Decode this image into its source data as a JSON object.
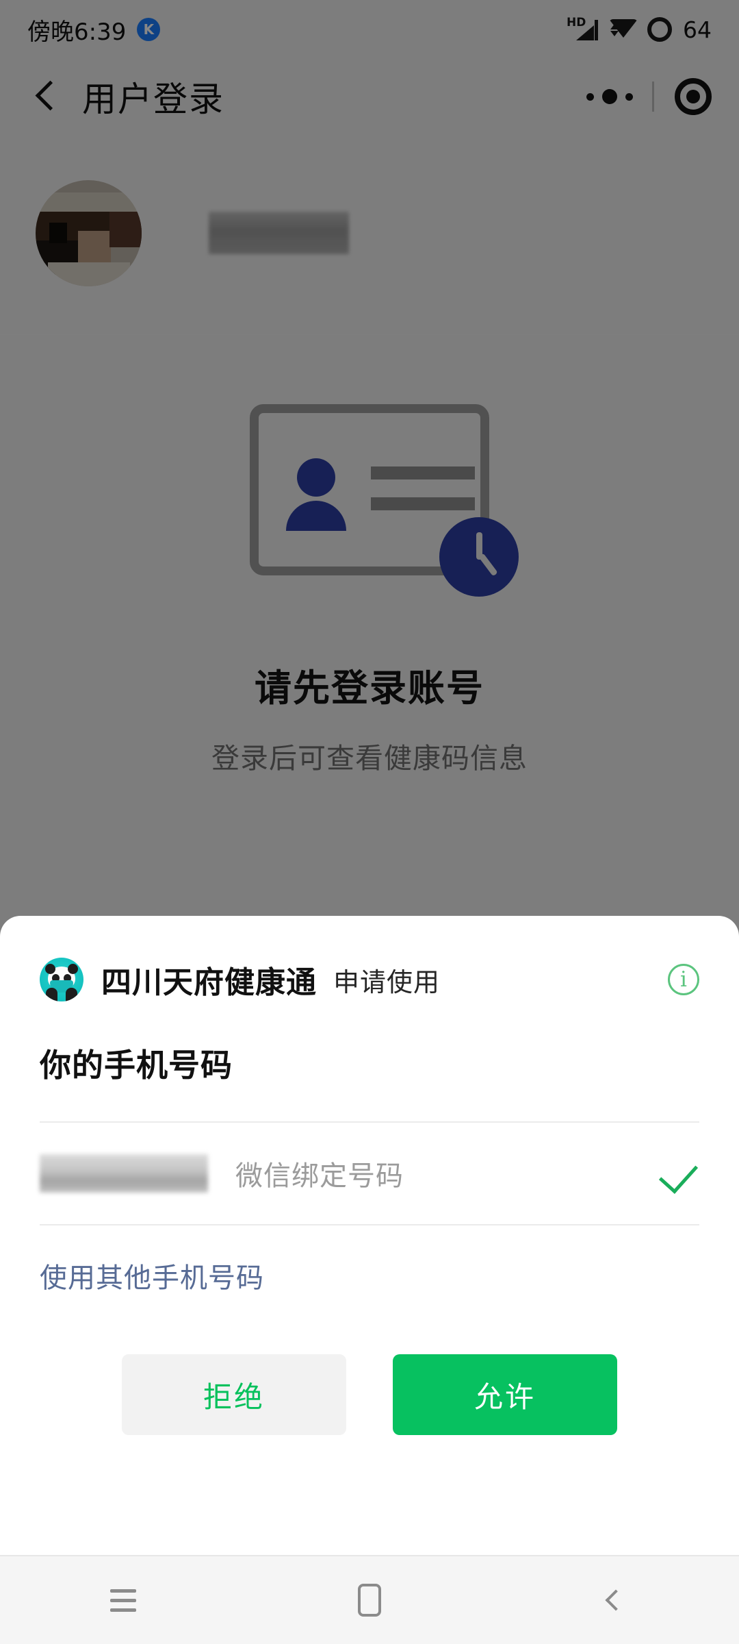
{
  "status_bar": {
    "time": "傍晚6:39",
    "app_badge": "K",
    "network_label": "HD",
    "battery_level": "64",
    "icons": [
      "hd-signal-icon",
      "wifi-icon",
      "battery-ring-icon"
    ]
  },
  "nav_bar": {
    "back_icon": "back-chevron-icon",
    "title": "用户登录",
    "menu_icon": "more-dots-icon",
    "close_icon": "target-circle-icon"
  },
  "profile": {
    "avatar": "user-avatar-pixelated",
    "username": "[已打码]"
  },
  "empty_state": {
    "illustration": "id-card-clock-icon",
    "title": "请先登录账号",
    "subtitle": "登录后可查看健康码信息",
    "card_border_color": "#9a9a9a",
    "accent_color": "#2c3ea0"
  },
  "auth_sheet": {
    "app_icon": "panda-app-icon",
    "app_name": "四川天府健康通",
    "action_text": "申请使用",
    "info_icon": "info-circle-icon",
    "info_icon_color": "#5bc47e",
    "scope_title": "你的手机号码",
    "phone": {
      "number": "[已打码]",
      "source_label": "微信绑定号码",
      "selected": true,
      "check_icon": "checkmark-icon",
      "check_color": "#1aad5a"
    },
    "other_phone_label": "使用其他手机号码",
    "other_phone_color": "#576b95",
    "buttons": {
      "deny_label": "拒绝",
      "allow_label": "允许",
      "deny_bg": "#f2f2f2",
      "deny_text_color": "#06c15c",
      "allow_bg": "#07c160",
      "allow_text_color": "#ffffff"
    }
  },
  "system_nav": {
    "recent_icon": "recents-menu-icon",
    "home_icon": "home-square-icon",
    "back_icon": "back-chevron-icon"
  }
}
